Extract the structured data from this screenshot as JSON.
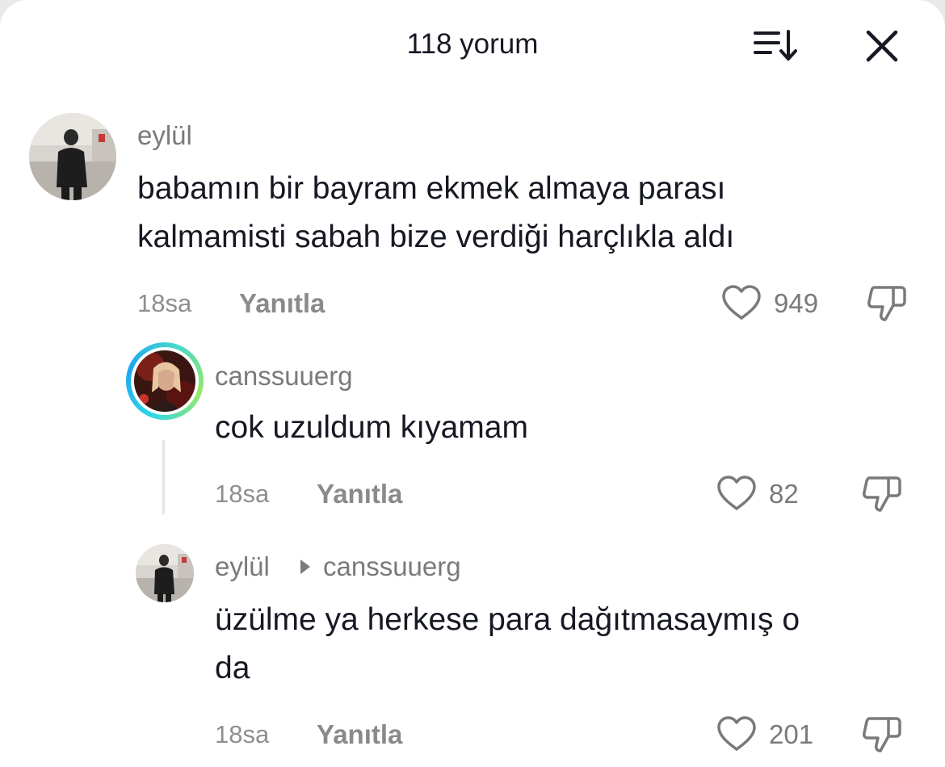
{
  "header": {
    "title": "118 yorum",
    "sort_icon": "sort-icon",
    "close_icon": "close-icon"
  },
  "comments": [
    {
      "username": "eylül",
      "text_lines": [
        "babamın bir bayram ekmek almaya parası",
        "kalmamisti sabah bize verdiği harçlıkla aldı"
      ],
      "time": "18sa",
      "reply_label": "Yanıtla",
      "likes": "949"
    },
    {
      "username": "canssuuerg",
      "text_lines": [
        "cok uzuldum kıyamam"
      ],
      "time": "18sa",
      "reply_label": "Yanıtla",
      "likes": "82"
    },
    {
      "username": "eylül",
      "reply_to": "canssuuerg",
      "text_lines": [
        "üzülme ya herkese para dağıtmasaymış o",
        "da"
      ],
      "time": "18sa",
      "reply_label": "Yanıtla",
      "likes": "201"
    }
  ],
  "colors": {
    "text": "#161823",
    "muted": "#7a7a7a",
    "story_ring": "#2fd6e8"
  }
}
